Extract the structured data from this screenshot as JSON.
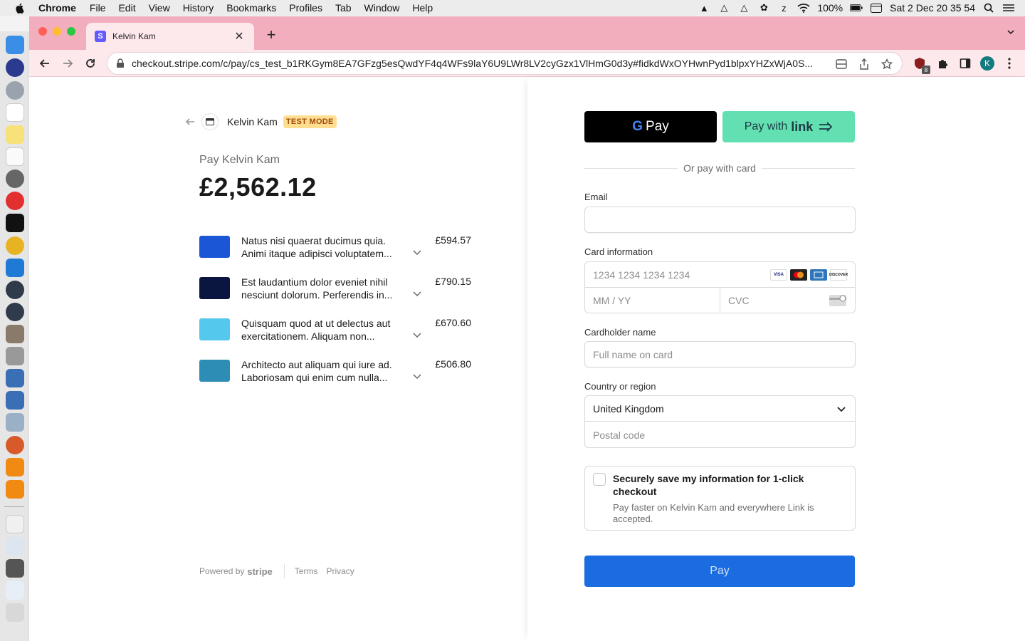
{
  "menubar": {
    "app_name": "Chrome",
    "menus": [
      "File",
      "Edit",
      "View",
      "History",
      "Bookmarks",
      "Profiles",
      "Tab",
      "Window",
      "Help"
    ],
    "battery": "100%",
    "datetime": "Sat 2 Dec  20 35 54"
  },
  "browser": {
    "tab_title": "Kelvin Kam",
    "tab_favicon": "S",
    "url": "checkout.stripe.com/c/pay/cs_test_b1RKGym8EA7GFzg5esQwdYF4q4WFs9laY6U9LWr8LV2cyGzx1VlHmG0d3y#fidkdWxOYHwnPyd1blpxYHZxWjA0S...",
    "profile_initial": "K",
    "ext_badge": "8"
  },
  "summary": {
    "merchant_name": "Kelvin Kam",
    "test_badge": "TEST MODE",
    "pay_label": "Pay Kelvin Kam",
    "amount": "£2,562.12",
    "items": [
      {
        "line1": "Natus nisi quaerat ducimus quia.",
        "line2": "Animi itaque adipisci voluptatem...",
        "price": "£594.57",
        "color": "#1a56d6"
      },
      {
        "line1": "Est laudantium dolor eveniet nihil",
        "line2": "nesciunt dolorum. Perferendis in...",
        "price": "£790.15",
        "color": "#0b1640"
      },
      {
        "line1": "Quisquam quod at ut delectus aut",
        "line2": "exercitationem. Aliquam non...",
        "price": "£670.60",
        "color": "#55c8ee"
      },
      {
        "line1": "Architecto aut aliquam qui iure ad.",
        "line2": "Laboriosam qui enim cum nulla...",
        "price": "£506.80",
        "color": "#2e8db5"
      }
    ],
    "footer": {
      "powered_by": "Powered by",
      "stripe": "stripe",
      "terms": "Terms",
      "privacy": "Privacy"
    }
  },
  "form": {
    "gpay_g": "G",
    "gpay_label": "Pay",
    "link_prefix": "Pay with",
    "link_word": "link",
    "or_text": "Or pay with card",
    "email_label": "Email",
    "email_value": "",
    "card_label": "Card information",
    "card_number_placeholder": "1234 1234 1234 1234",
    "expiry_placeholder": "MM / YY",
    "cvc_placeholder": "CVC",
    "brands": [
      "VISA",
      "MC",
      "AMEX",
      "DISCOVER"
    ],
    "cardholder_label": "Cardholder name",
    "cardholder_placeholder": "Full name on card",
    "country_label": "Country or region",
    "country_value": "United Kingdom",
    "postal_placeholder": "Postal code",
    "save_title": "Securely save my information for 1-click checkout",
    "save_sub": "Pay faster on Kelvin Kam and everywhere Link is accepted.",
    "pay_button": "Pay"
  }
}
